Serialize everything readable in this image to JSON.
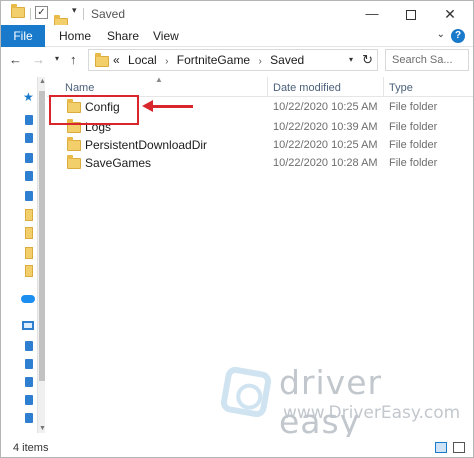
{
  "window": {
    "title": "Saved"
  },
  "title_bar": {
    "minimize_label": "—",
    "close_label": "✕"
  },
  "ribbon": {
    "tabs": [
      {
        "label": "File"
      },
      {
        "label": "Home"
      },
      {
        "label": "Share"
      },
      {
        "label": "View"
      }
    ],
    "help_label": "?"
  },
  "navigation": {
    "back_label": "←",
    "forward_label": "→",
    "up_label": "↑",
    "breadcrumb_prefix": "«",
    "breadcrumb": [
      "Local",
      "FortniteGame",
      "Saved"
    ],
    "search_placeholder": "Search Sa..."
  },
  "columns": [
    {
      "label": "Name"
    },
    {
      "label": "Date modified"
    },
    {
      "label": "Type"
    }
  ],
  "files": [
    {
      "name": "Config",
      "date": "10/22/2020 10:25 AM",
      "type": "File folder"
    },
    {
      "name": "Logs",
      "date": "10/22/2020 10:39 AM",
      "type": "File folder"
    },
    {
      "name": "PersistentDownloadDir",
      "date": "10/22/2020 10:25 AM",
      "type": "File folder"
    },
    {
      "name": "SaveGames",
      "date": "10/22/2020 10:28 AM",
      "type": "File folder"
    }
  ],
  "annotation": {
    "highlight_color": "#d9262c"
  },
  "watermark": {
    "brand": "driver easy",
    "url": "www.DriverEasy.com"
  },
  "status_bar": {
    "item_count": "4 items"
  },
  "colors": {
    "accent": "#1979ca",
    "folder": "#f3cf6b"
  }
}
